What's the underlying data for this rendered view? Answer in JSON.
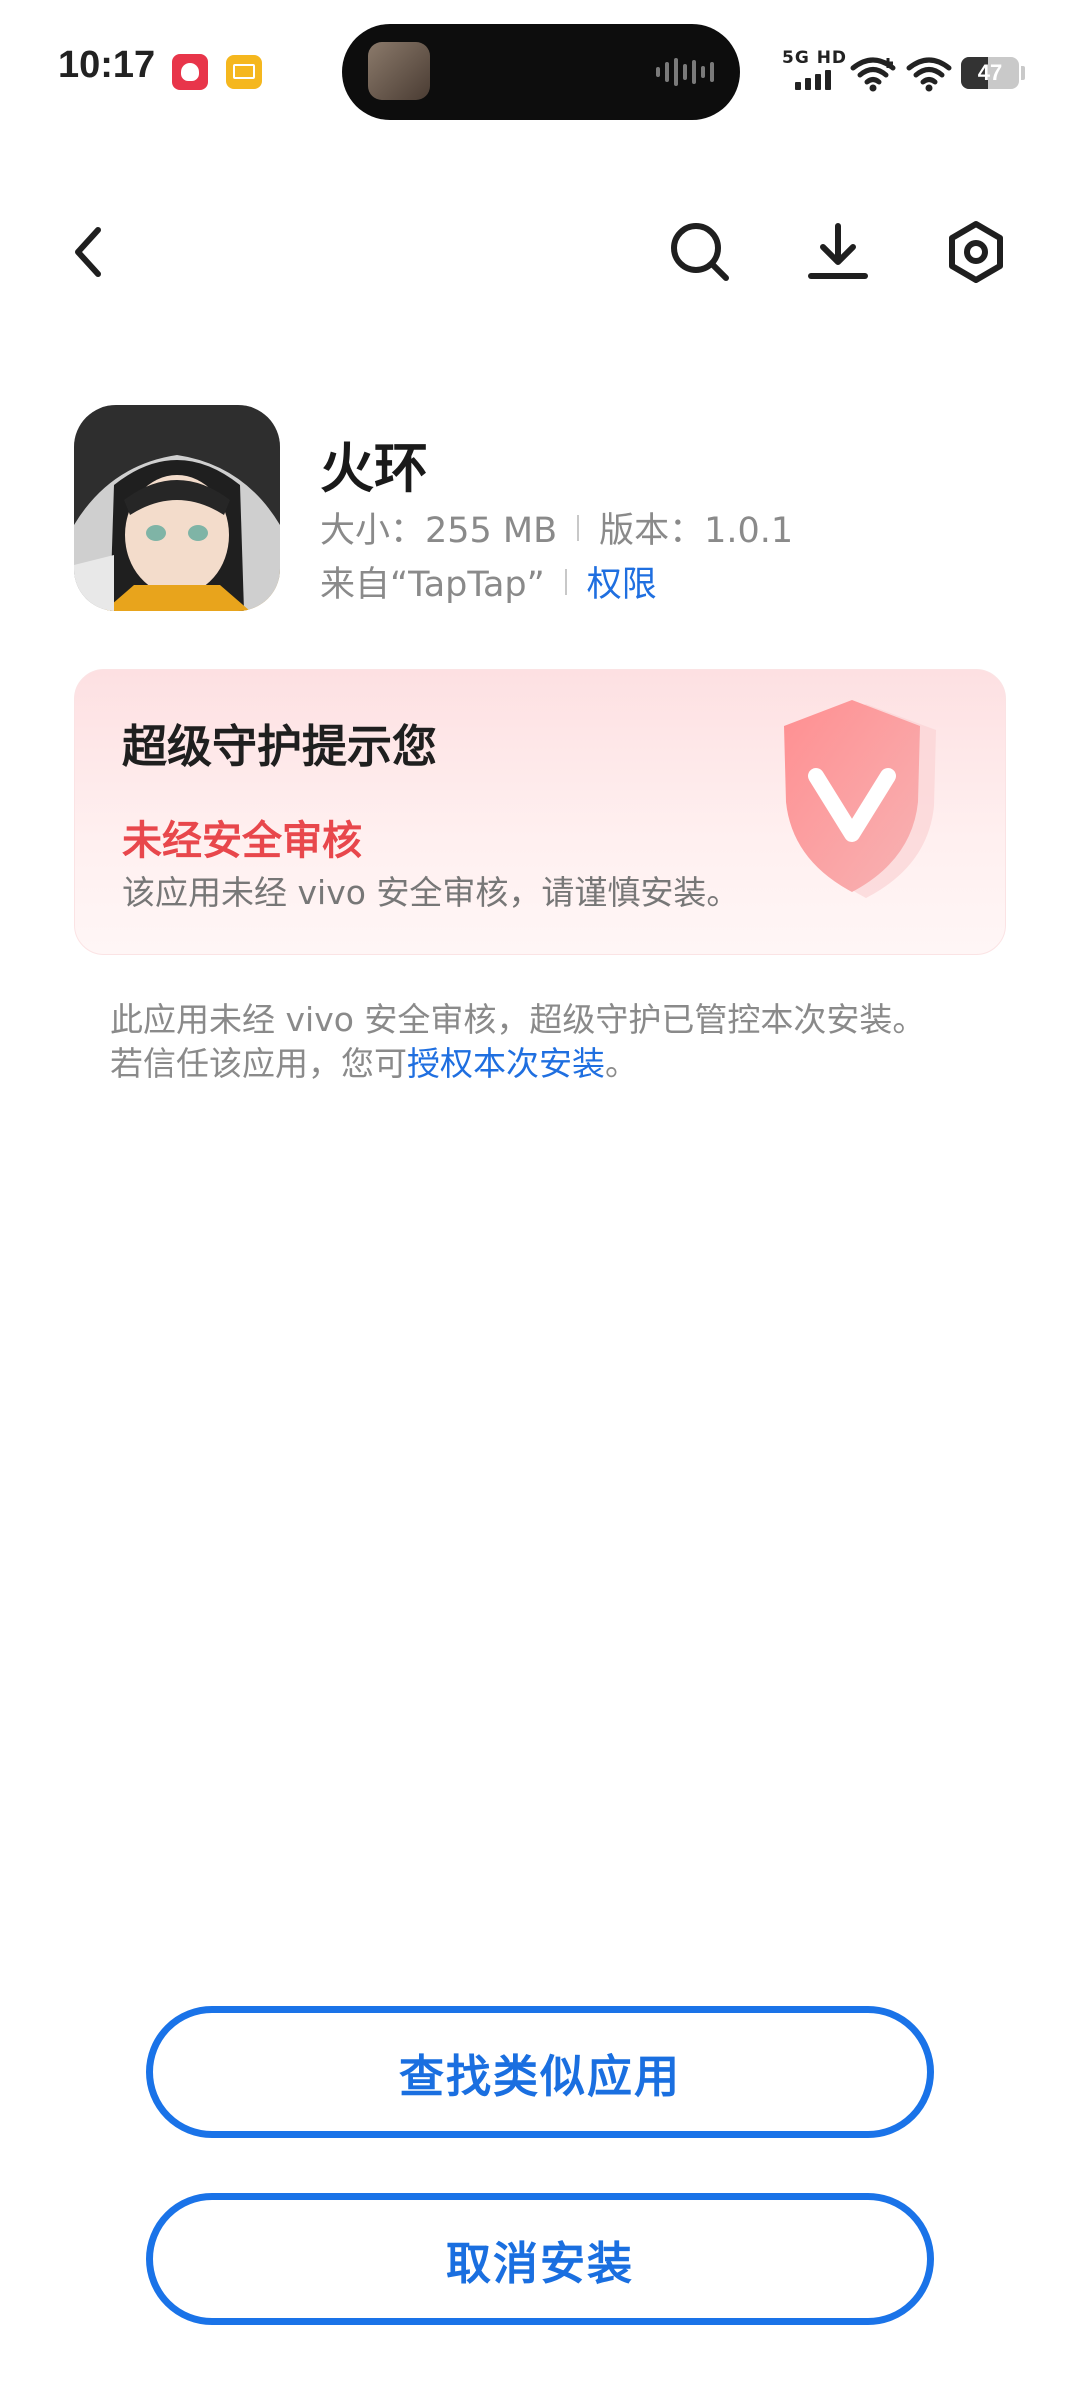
{
  "status_bar": {
    "time": "10:17",
    "network_label": "5G HD",
    "battery_level": "47",
    "notification_icons": [
      "app-badge-icon",
      "mail-icon"
    ]
  },
  "toolbar": {
    "icons": [
      "back-arrow-icon",
      "search-icon",
      "download-icon",
      "settings-hexagon-icon"
    ]
  },
  "app": {
    "name": "火环",
    "size_text": "大小：255 MB",
    "version_text": "版本：1.0.1",
    "source_text": "来自“TapTap”",
    "permissions_link": "权限"
  },
  "protection_card": {
    "title": "超级守护提示您",
    "warning": "未经安全审核",
    "description": "该应用未经 vivo 安全审核，请谨慎安装。",
    "badge_icon": "vivo-shield-icon",
    "accent_color": "#e8474c"
  },
  "notice": {
    "line1": "此应用未经 vivo 安全审核，超级守护已管控本次安装。",
    "line2_prefix": "若信任该应用，您可",
    "line2_link": "授权本次安装",
    "line2_suffix": "。"
  },
  "actions": {
    "find_similar": "查找类似应用",
    "cancel_install": "取消安装"
  },
  "colors": {
    "primary": "#1a73e8",
    "link": "#1f6fe0",
    "warning": "#e8474c"
  }
}
